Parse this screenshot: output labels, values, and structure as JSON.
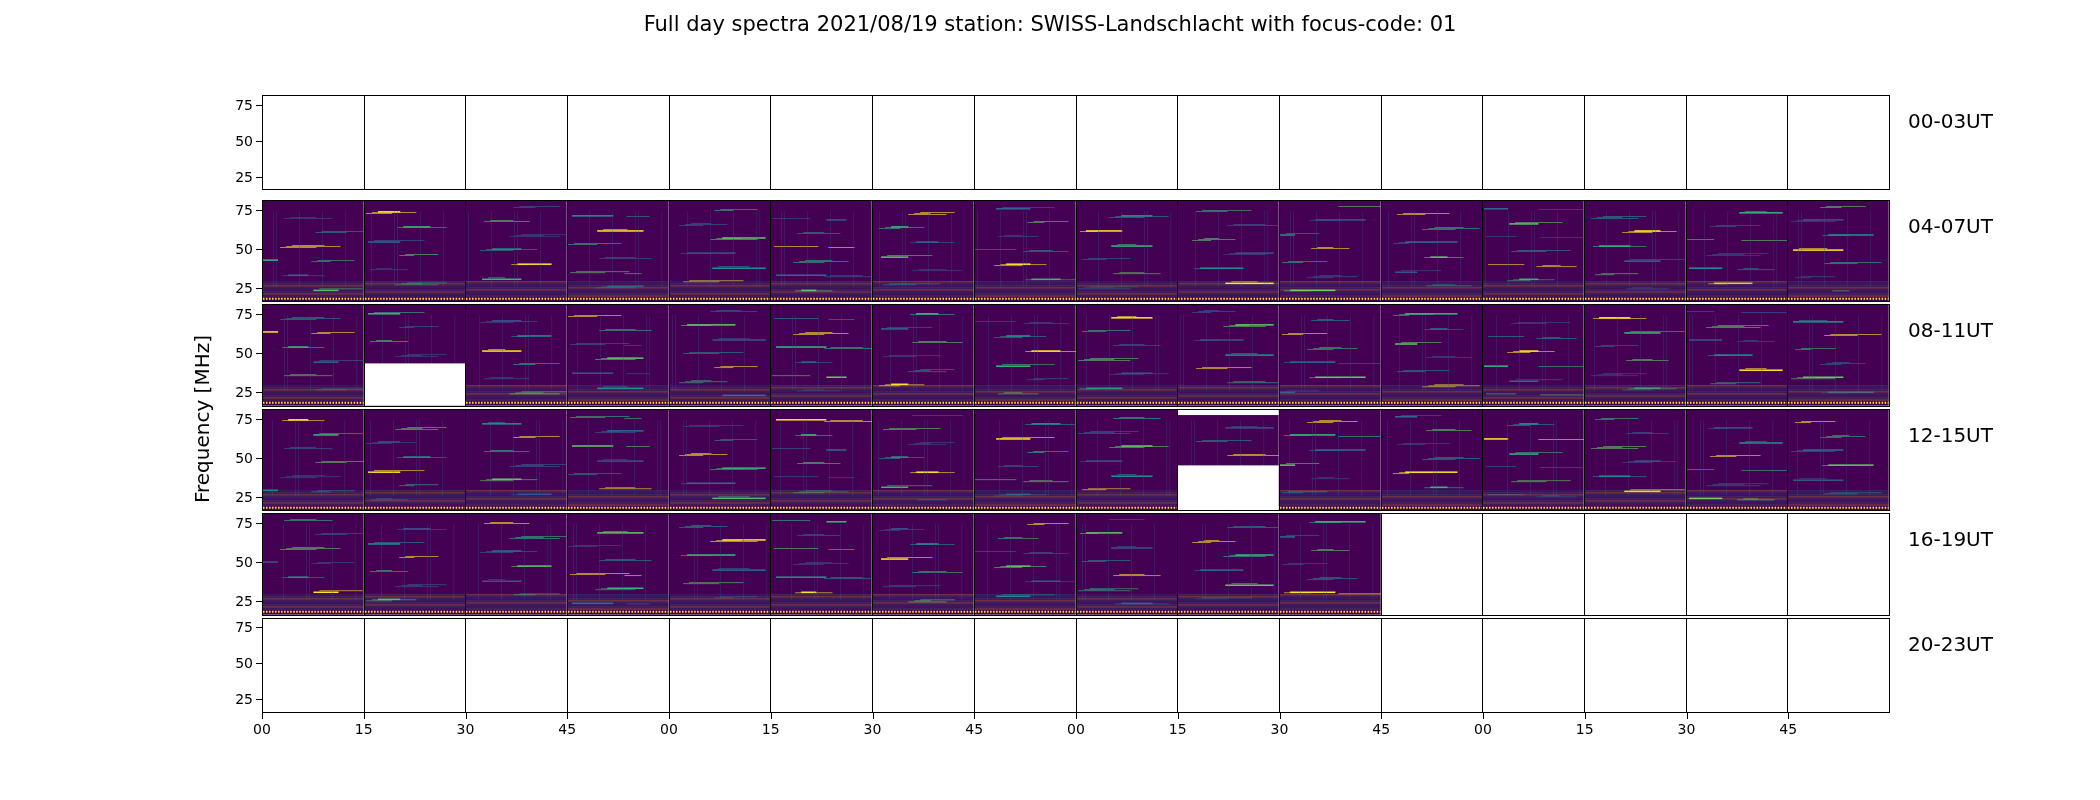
{
  "title": "Full day spectra 2021/08/19 station: SWISS-Landschlacht with focus-code: 01",
  "ylabel": "Frequency [MHz]",
  "rows": [
    {
      "label": "00-03UT",
      "yticks": [
        "75",
        "50",
        "25"
      ],
      "panels": [
        {
          "kind": "empty"
        },
        {
          "kind": "empty"
        },
        {
          "kind": "empty"
        },
        {
          "kind": "empty"
        },
        {
          "kind": "empty"
        },
        {
          "kind": "empty"
        },
        {
          "kind": "empty"
        },
        {
          "kind": "empty"
        },
        {
          "kind": "empty"
        },
        {
          "kind": "empty"
        },
        {
          "kind": "empty"
        },
        {
          "kind": "empty"
        },
        {
          "kind": "empty"
        },
        {
          "kind": "empty"
        },
        {
          "kind": "empty"
        },
        {
          "kind": "empty"
        }
      ]
    },
    {
      "label": "04-07UT",
      "yticks": [
        "75",
        "50",
        "25"
      ],
      "panels": [
        {
          "kind": "spectrum"
        },
        {
          "kind": "spectrum"
        },
        {
          "kind": "spectrum"
        },
        {
          "kind": "spectrum"
        },
        {
          "kind": "spectrum"
        },
        {
          "kind": "spectrum"
        },
        {
          "kind": "spectrum"
        },
        {
          "kind": "spectrum"
        },
        {
          "kind": "spectrum"
        },
        {
          "kind": "spectrum"
        },
        {
          "kind": "spectrum"
        },
        {
          "kind": "spectrum"
        },
        {
          "kind": "spectrum"
        },
        {
          "kind": "spectrum"
        },
        {
          "kind": "spectrum"
        },
        {
          "kind": "spectrum"
        }
      ]
    },
    {
      "label": "08-11UT",
      "yticks": [
        "75",
        "50",
        "25"
      ],
      "panels": [
        {
          "kind": "spectrum"
        },
        {
          "kind": "cut-low"
        },
        {
          "kind": "spectrum"
        },
        {
          "kind": "spectrum"
        },
        {
          "kind": "spectrum"
        },
        {
          "kind": "spectrum"
        },
        {
          "kind": "spectrum"
        },
        {
          "kind": "spectrum"
        },
        {
          "kind": "spectrum"
        },
        {
          "kind": "spectrum"
        },
        {
          "kind": "spectrum"
        },
        {
          "kind": "spectrum"
        },
        {
          "kind": "spectrum"
        },
        {
          "kind": "spectrum"
        },
        {
          "kind": "spectrum"
        },
        {
          "kind": "spectrum"
        }
      ]
    },
    {
      "label": "12-15UT",
      "yticks": [
        "75",
        "50",
        "25"
      ],
      "panels": [
        {
          "kind": "spectrum"
        },
        {
          "kind": "spectrum"
        },
        {
          "kind": "spectrum"
        },
        {
          "kind": "spectrum"
        },
        {
          "kind": "spectrum"
        },
        {
          "kind": "spectrum"
        },
        {
          "kind": "spectrum"
        },
        {
          "kind": "spectrum"
        },
        {
          "kind": "spectrum"
        },
        {
          "kind": "cut-both"
        },
        {
          "kind": "spectrum"
        },
        {
          "kind": "spectrum"
        },
        {
          "kind": "spectrum"
        },
        {
          "kind": "spectrum"
        },
        {
          "kind": "spectrum"
        },
        {
          "kind": "spectrum"
        }
      ]
    },
    {
      "label": "16-19UT",
      "yticks": [
        "75",
        "50",
        "25"
      ],
      "panels": [
        {
          "kind": "spectrum"
        },
        {
          "kind": "spectrum"
        },
        {
          "kind": "spectrum"
        },
        {
          "kind": "spectrum"
        },
        {
          "kind": "spectrum"
        },
        {
          "kind": "spectrum"
        },
        {
          "kind": "spectrum"
        },
        {
          "kind": "spectrum"
        },
        {
          "kind": "spectrum"
        },
        {
          "kind": "spectrum"
        },
        {
          "kind": "spectrum"
        },
        {
          "kind": "empty"
        },
        {
          "kind": "empty"
        },
        {
          "kind": "empty"
        },
        {
          "kind": "empty"
        },
        {
          "kind": "empty"
        }
      ]
    },
    {
      "label": "20-23UT",
      "yticks": [
        "75",
        "50",
        "25"
      ],
      "panels": [
        {
          "kind": "empty"
        },
        {
          "kind": "empty"
        },
        {
          "kind": "empty"
        },
        {
          "kind": "empty"
        },
        {
          "kind": "empty"
        },
        {
          "kind": "empty"
        },
        {
          "kind": "empty"
        },
        {
          "kind": "empty"
        },
        {
          "kind": "empty"
        },
        {
          "kind": "empty"
        },
        {
          "kind": "empty"
        },
        {
          "kind": "empty"
        },
        {
          "kind": "empty"
        },
        {
          "kind": "empty"
        },
        {
          "kind": "empty"
        },
        {
          "kind": "empty"
        }
      ]
    }
  ],
  "xticks": [
    "00",
    "15",
    "30",
    "45",
    "00",
    "15",
    "30",
    "45",
    "00",
    "15",
    "30",
    "45",
    "00",
    "15",
    "30",
    "45"
  ]
}
